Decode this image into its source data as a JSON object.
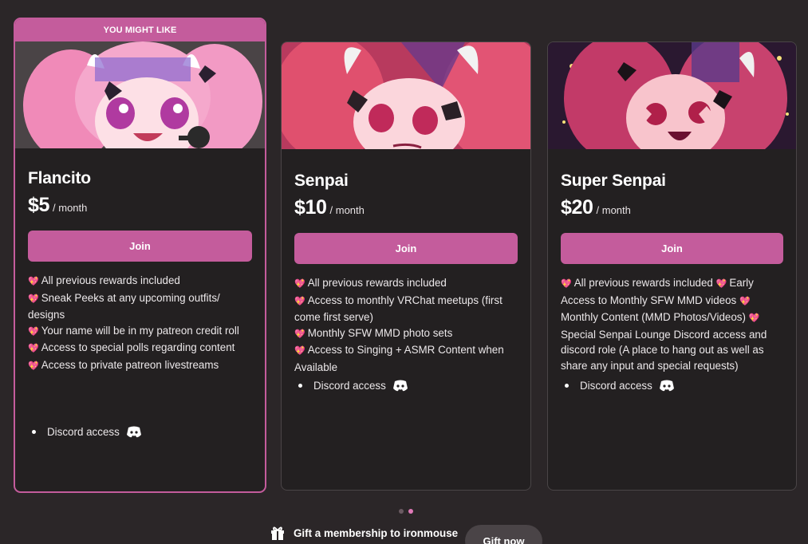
{
  "featured_label": "YOU MIGHT LIKE",
  "colors": {
    "accent": "#c45c9c",
    "background": "#2b2628",
    "card": "#232021"
  },
  "tiers": [
    {
      "name": "Flancito",
      "price": "$5",
      "period": "/ month",
      "join_label": "Join",
      "image_icon": "tier-artwork",
      "benefits": [
        "All previous rewards included",
        "Sneak Peeks at any upcoming outfits/",
        "designs",
        "Your name will be in my patreon credit roll",
        "Access to special polls regarding content",
        "Access to private patreon livestreams"
      ],
      "discord": "Discord access"
    },
    {
      "name": "Senpai",
      "price": "$10",
      "period": "/ month",
      "join_label": "Join",
      "image_icon": "tier-artwork",
      "benefits": [
        "All previous rewards included",
        "Access to monthly VRChat meetups (first",
        "come first serve)",
        "Monthly SFW MMD photo sets",
        "Access to Singing + ASMR Content when",
        "Available"
      ],
      "discord": "Discord access"
    },
    {
      "name": "Super Senpai",
      "price": "$20",
      "period": "/ month",
      "join_label": "Join",
      "image_icon": "tier-artwork",
      "benefits": [
        "All previous rewards included",
        "Early",
        "Access to Monthly SFW MMD videos",
        "Monthly Content (MMD Photos/Videos)",
        "Special Senpai Lounge Discord access and",
        "discord role (A place to hang out as well as",
        "share any input and special requests)"
      ],
      "discord": "Discord access"
    }
  ],
  "gift": {
    "text": "Gift a membership to ironmouse",
    "button": "Gift now"
  }
}
